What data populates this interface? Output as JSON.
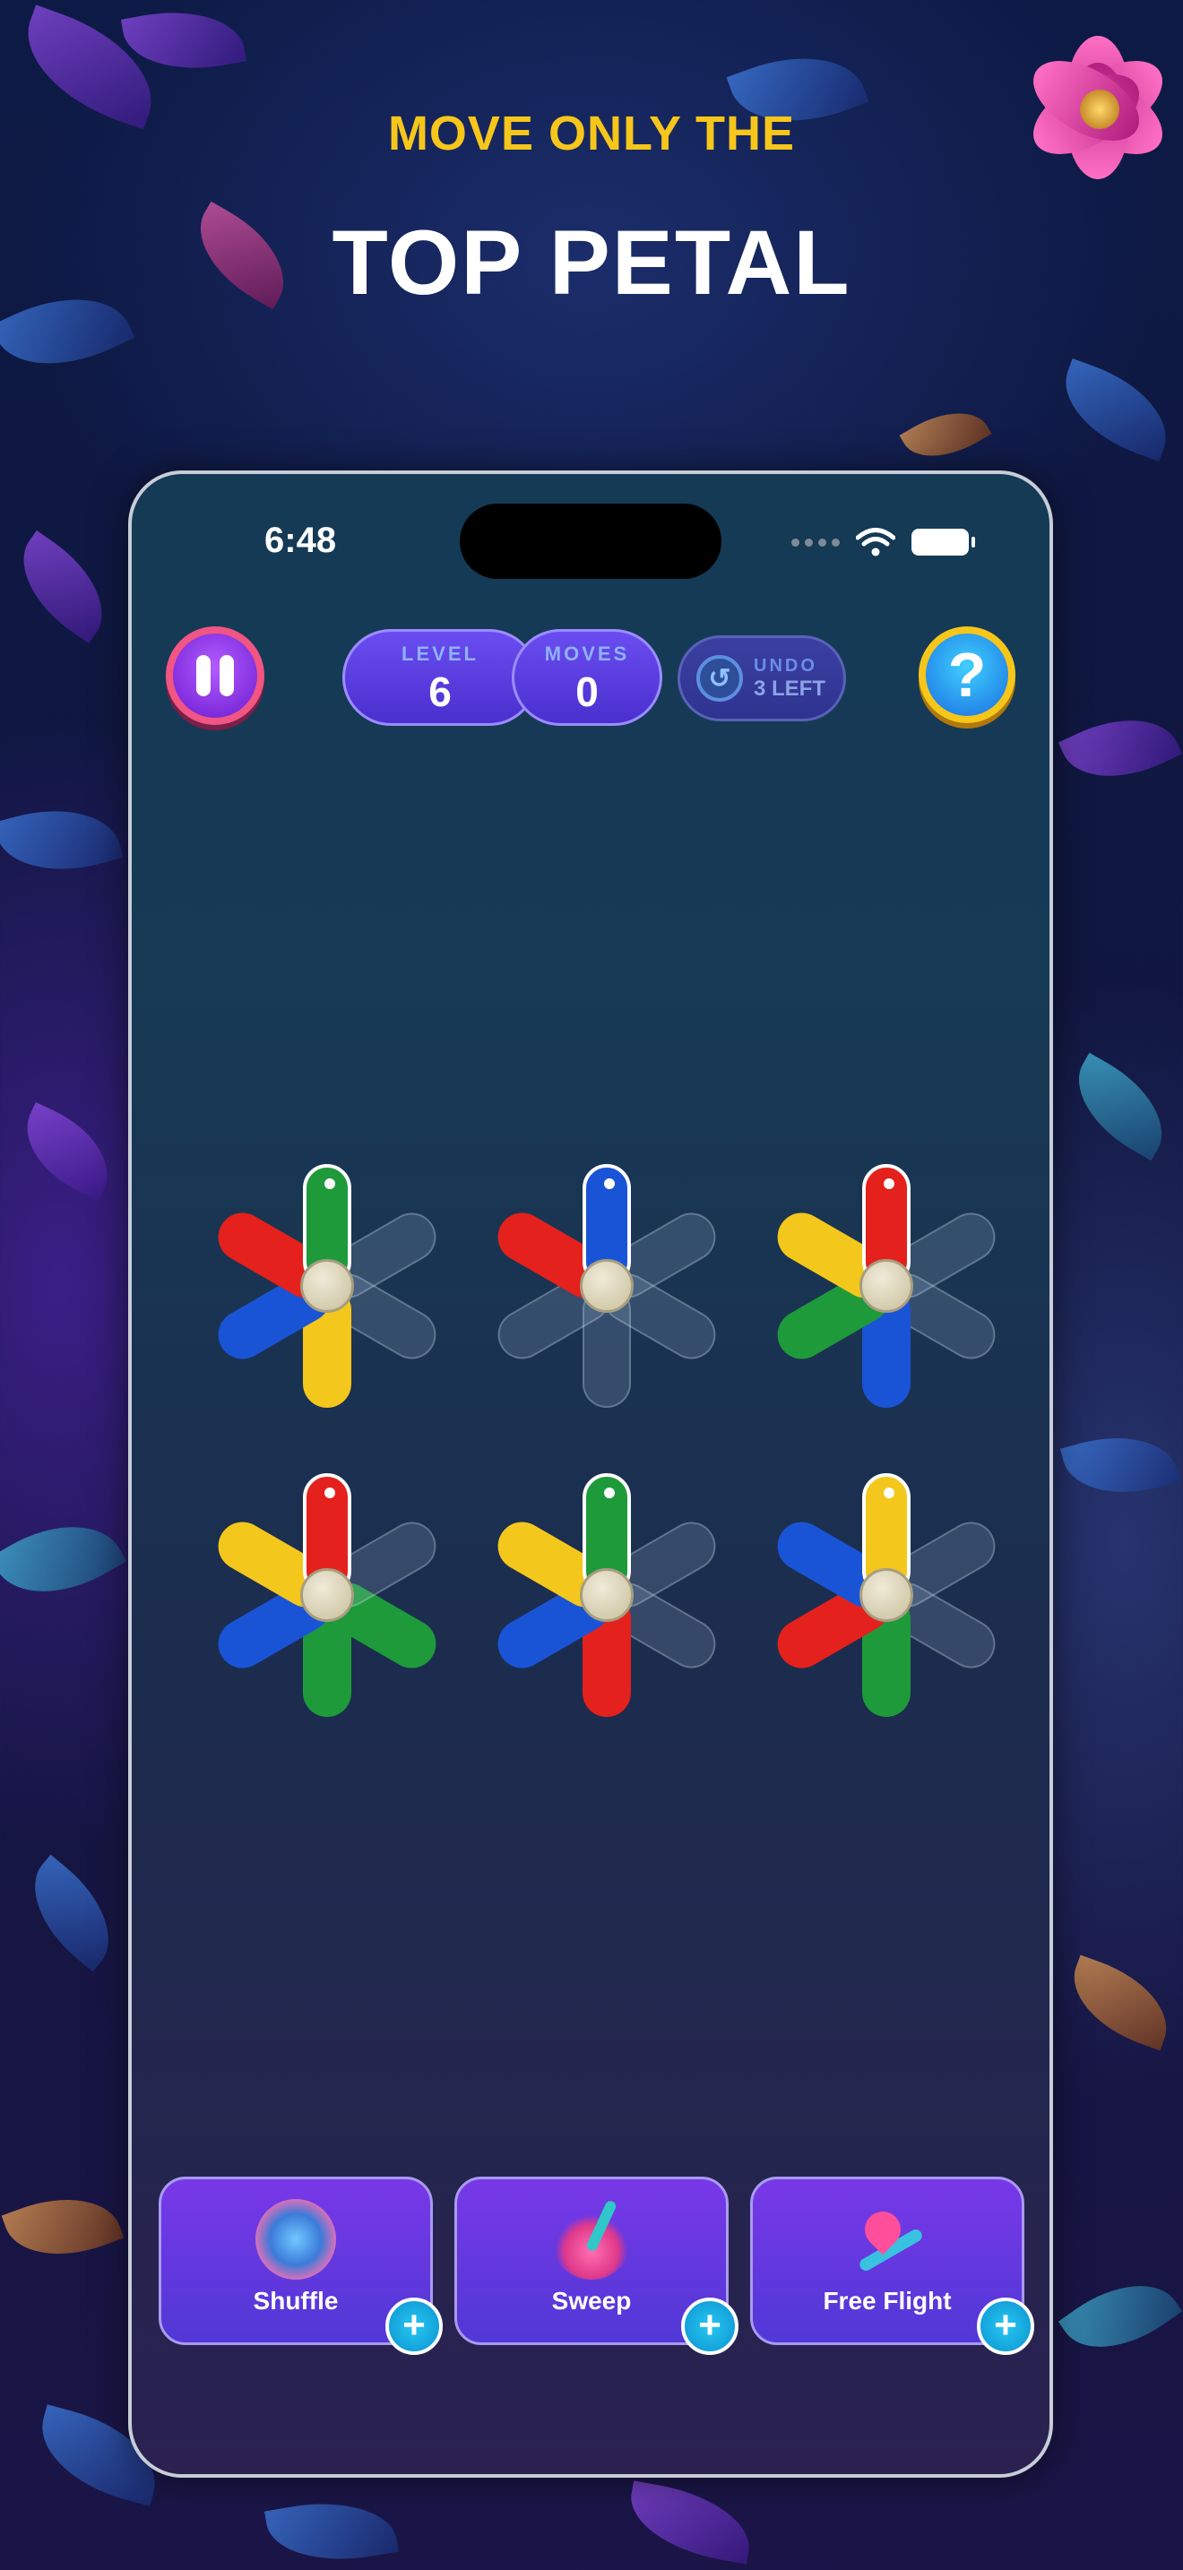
{
  "headline": {
    "top": "MOVE ONLY THE",
    "main": "TOP PETAL"
  },
  "status_bar": {
    "time": "6:48",
    "icons": [
      "signal-dots-icon",
      "wifi-icon",
      "battery-icon"
    ]
  },
  "hud": {
    "pause_icon": "pause-icon",
    "level": {
      "label": "LEVEL",
      "value": "6"
    },
    "moves": {
      "label": "MOVES",
      "value": "0"
    },
    "undo": {
      "label": "UNDO",
      "remaining": "3 LEFT",
      "icon": "undo-icon"
    },
    "help_icon": "question-icon",
    "help_glyph": "?"
  },
  "pinwheels": [
    {
      "petals": [
        "green",
        "red",
        "blue",
        "yellow",
        "empty",
        "empty"
      ]
    },
    {
      "petals": [
        "blue",
        "red",
        "empty",
        "empty",
        "empty",
        "empty"
      ]
    },
    {
      "petals": [
        "red",
        "yellow",
        "green",
        "blue",
        "empty",
        "empty"
      ]
    },
    {
      "petals": [
        "red",
        "yellow",
        "blue",
        "green",
        "green",
        "empty"
      ]
    },
    {
      "petals": [
        "green",
        "yellow",
        "blue",
        "red",
        "empty",
        "empty"
      ]
    },
    {
      "petals": [
        "yellow",
        "blue",
        "red",
        "green",
        "empty",
        "empty"
      ]
    }
  ],
  "colors": {
    "green": "#1e9a3b",
    "red": "#e4211c",
    "blue": "#1a54d6",
    "yellow": "#f4c71c",
    "headline_accent": "#f7c61b"
  },
  "boosters": [
    {
      "label": "Shuffle",
      "icon": "shuffle-icon",
      "add_glyph": "+"
    },
    {
      "label": "Sweep",
      "icon": "broom-icon",
      "add_glyph": "+"
    },
    {
      "label": "Free Flight",
      "icon": "flight-icon",
      "add_glyph": "+"
    }
  ]
}
